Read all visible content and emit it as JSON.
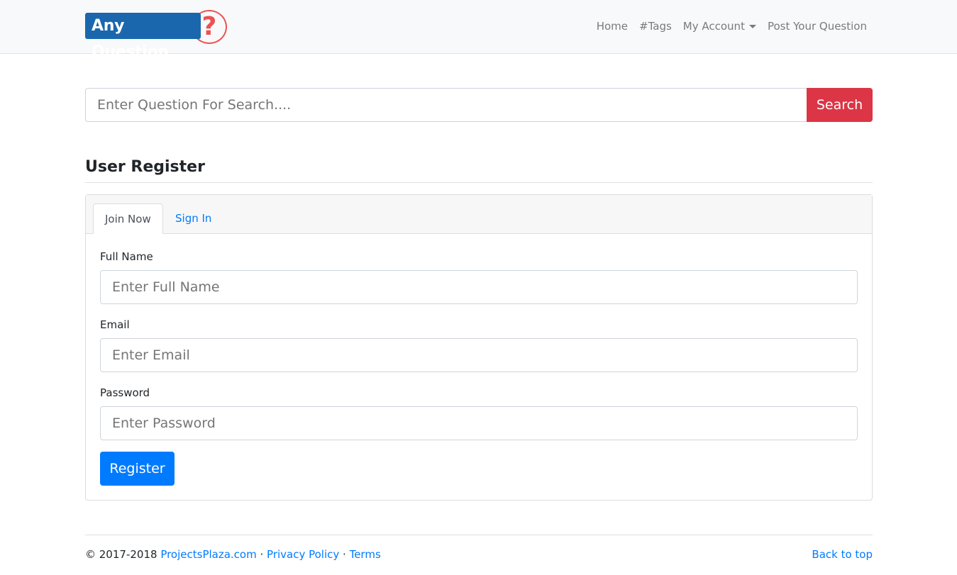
{
  "brand": {
    "name": "Any Question",
    "mark": "?"
  },
  "nav": {
    "home": "Home",
    "tags": "#Tags",
    "account": "My Account",
    "post": "Post Your Question"
  },
  "search": {
    "placeholder": "Enter Question For Search....",
    "button": "Search"
  },
  "page_title": "User Register",
  "tabs": {
    "join": "Join Now",
    "signin": "Sign In"
  },
  "form": {
    "fullname_label": "Full Name",
    "fullname_placeholder": "Enter Full Name",
    "email_label": "Email",
    "email_placeholder": "Enter Email",
    "password_label": "Password",
    "password_placeholder": "Enter Password",
    "register": "Register"
  },
  "footer": {
    "copyright": "© 2017-2018",
    "site": "ProjectsPlaza.com",
    "sep": " · ",
    "privacy": "Privacy Policy",
    "terms": "Terms",
    "back": "Back to top"
  }
}
